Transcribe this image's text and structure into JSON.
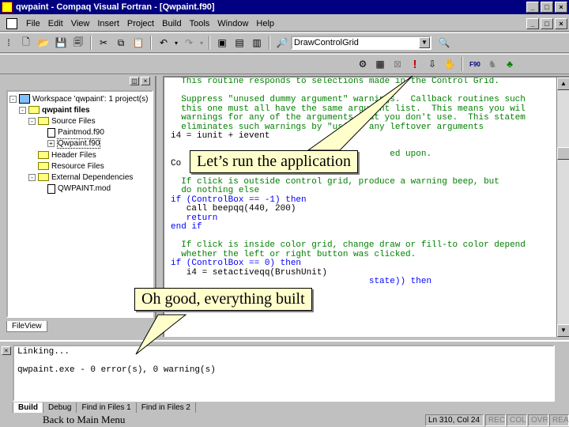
{
  "window": {
    "title": "qwpaint - Compaq Visual Fortran - [Qwpaint.f90]",
    "controls": [
      "_",
      "□",
      "×"
    ]
  },
  "menubar": {
    "items": [
      "File",
      "Edit",
      "View",
      "Insert",
      "Project",
      "Build",
      "Tools",
      "Window",
      "Help"
    ]
  },
  "toolbar": {
    "function_combo": "DrawControlGrid"
  },
  "workspace": {
    "tree": [
      {
        "label": "Workspace 'qwpaint': 1 project(s)",
        "indent": 0,
        "kind": "workspace",
        "expander": "-"
      },
      {
        "label": "qwpaint files",
        "indent": 1,
        "kind": "project",
        "expander": "-"
      },
      {
        "label": "Source Files",
        "indent": 2,
        "kind": "folder",
        "expander": "-"
      },
      {
        "label": "Paintmod.f90",
        "indent": 3,
        "kind": "file",
        "expander": ""
      },
      {
        "label": "Qwpaint.f90",
        "indent": 3,
        "kind": "file",
        "expander": "+"
      },
      {
        "label": "Header Files",
        "indent": 2,
        "kind": "folder",
        "expander": ""
      },
      {
        "label": "Resource Files",
        "indent": 2,
        "kind": "folder",
        "expander": ""
      },
      {
        "label": "External Dependencies",
        "indent": 2,
        "kind": "folder",
        "expander": "-"
      },
      {
        "label": "QWPAINT.mod",
        "indent": 3,
        "kind": "file",
        "expander": ""
      }
    ],
    "tab_label": "FileView"
  },
  "editor": {
    "lines": [
      {
        "text": "  This routine responds to selections made in the Control Grid.",
        "cls": "c"
      },
      {
        "text": "",
        "cls": ""
      },
      {
        "text": "  Suppress \"unused dummy argument\" warnings.  Callback routines such",
        "cls": "c"
      },
      {
        "text": "  this one must all have the same argument list.  This means you wil",
        "cls": "c"
      },
      {
        "text": "  warnings for any of the arguments that you don't use.  This statem",
        "cls": "c"
      },
      {
        "text": "  eliminates such warnings by \"using\" any leftover arguments",
        "cls": "c"
      },
      {
        "text": "i4 = iunit + ievent",
        "cls": ""
      },
      {
        "text": "",
        "cls": ""
      },
      {
        "text": "                                          ed upon.",
        "cls": "c"
      },
      {
        "text": "Co",
        "cls": ""
      },
      {
        "text": "",
        "cls": ""
      },
      {
        "text": "  If click is outside control grid, produce a warning beep, but",
        "cls": "c"
      },
      {
        "text": "  do nothing else",
        "cls": "c"
      },
      {
        "text": "if (ControlBox == -1) then",
        "cls": "k"
      },
      {
        "text": "   call beepqq(440, 200)",
        "cls": ""
      },
      {
        "text": "   return",
        "cls": "k"
      },
      {
        "text": "end if",
        "cls": "k"
      },
      {
        "text": "",
        "cls": ""
      },
      {
        "text": "  If click is inside color grid, change draw or fill-to color depend",
        "cls": "c"
      },
      {
        "text": "  whether the left or right button was clicked.",
        "cls": "c"
      },
      {
        "text": "if (ControlBox == 0) then",
        "cls": "k"
      },
      {
        "text": "   i4 = setactiveqq(BrushUnit)",
        "cls": ""
      },
      {
        "text": "                                      state)) then",
        "cls": "k"
      },
      {
        "text": "",
        "cls": ""
      },
      {
        "text": "",
        "cls": ""
      },
      {
        "text": "   if",
        "cls": "k"
      }
    ]
  },
  "output": {
    "lines": [
      "Linking...",
      "",
      "qwpaint.exe - 0 error(s), 0 warning(s)"
    ],
    "tabs": [
      "Build",
      "Debug",
      "Find in Files 1",
      "Find in Files 2"
    ],
    "active_tab": "Build"
  },
  "statusbar": {
    "back_link": "Back to Main Menu",
    "position": "Ln 310, Col 24",
    "indicators": [
      "REC",
      "COL",
      "OVR",
      "READ"
    ]
  },
  "callouts": {
    "run": "Let’s run the application",
    "built": "Oh good, everything built"
  },
  "colors": {
    "titlebar": "#000080",
    "comment": "#008000",
    "keyword": "#0000ff",
    "callout_bg": "#ffffcc"
  }
}
